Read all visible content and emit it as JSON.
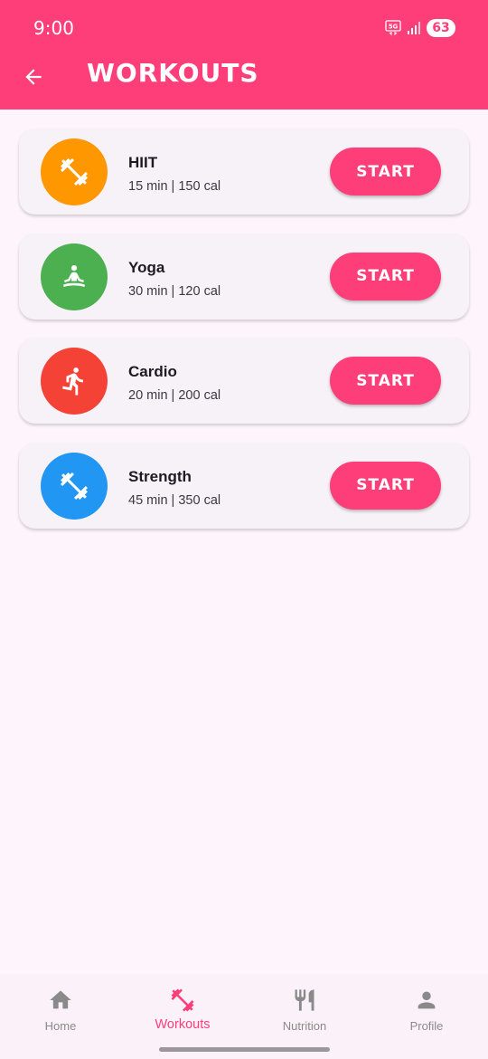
{
  "status_bar": {
    "time": "9:00",
    "network": "5G",
    "battery": "63"
  },
  "header": {
    "title": "WORKOUTS",
    "back_icon": "arrow-back-icon"
  },
  "workouts": [
    {
      "name": "HIIT",
      "meta": "15 min | 150 cal",
      "icon": "dumbbell-icon",
      "color": "#ff9800",
      "action": "START"
    },
    {
      "name": "Yoga",
      "meta": "30 min | 120 cal",
      "icon": "meditation-icon",
      "color": "#4caf50",
      "action": "START"
    },
    {
      "name": "Cardio",
      "meta": "20 min | 200 cal",
      "icon": "running-icon",
      "color": "#f44336",
      "action": "START"
    },
    {
      "name": "Strength",
      "meta": "45 min | 350 cal",
      "icon": "dumbbell-icon",
      "color": "#2196f3",
      "action": "START"
    }
  ],
  "bottom_nav": [
    {
      "label": "Home",
      "icon": "home-icon",
      "active": false
    },
    {
      "label": "Workouts",
      "icon": "dumbbell-icon",
      "active": true
    },
    {
      "label": "Nutrition",
      "icon": "restaurant-icon",
      "active": false
    },
    {
      "label": "Profile",
      "icon": "person-icon",
      "active": false
    }
  ],
  "colors": {
    "accent": "#fe3e78",
    "background": "#fdf5fb",
    "inactive": "#8a8a8a"
  }
}
